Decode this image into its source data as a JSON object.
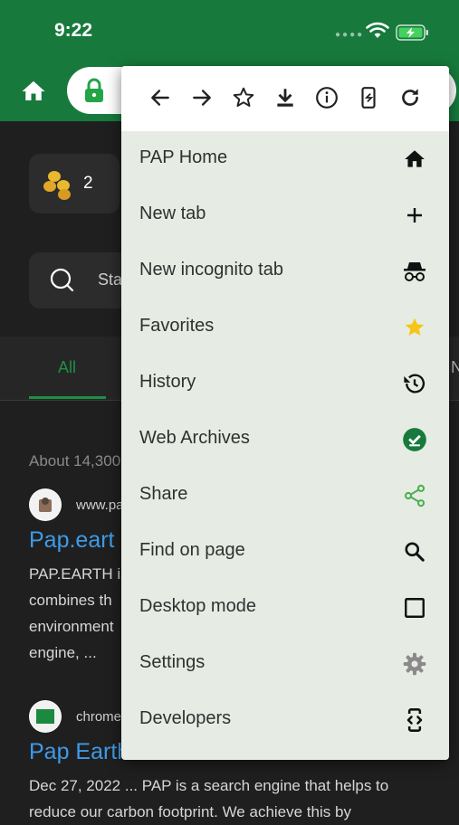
{
  "status_bar": {
    "time": "9:22"
  },
  "background_page": {
    "coins": {
      "count": "2"
    },
    "search": {
      "placeholder": "Sta"
    },
    "tabs": [
      {
        "label": "All"
      },
      {
        "label": "N"
      }
    ],
    "results_count": "About 14,300",
    "results": [
      {
        "domain": "www.pa",
        "title": "Pap.eart",
        "snippet": [
          "PAP.EARTH is",
          "combines th",
          "environment",
          "engine, ..."
        ]
      },
      {
        "domain": "chrome",
        "title": "Pap Earth",
        "snippet": [
          "Dec 27, 2022 ... PAP is a search engine that helps to",
          "reduce our carbon footprint. We achieve this by"
        ]
      }
    ]
  },
  "menu": {
    "toolbar": [
      {
        "icon": "back-arrow-icon"
      },
      {
        "icon": "forward-arrow-icon"
      },
      {
        "icon": "star-outline-icon"
      },
      {
        "icon": "download-icon"
      },
      {
        "icon": "info-icon"
      },
      {
        "icon": "phone-view-icon"
      },
      {
        "icon": "refresh-icon"
      }
    ],
    "items": [
      {
        "label": "PAP Home",
        "icon": "home-icon"
      },
      {
        "label": "New tab",
        "icon": "plus-icon"
      },
      {
        "label": "New incognito tab",
        "icon": "incognito-icon"
      },
      {
        "label": "Favorites",
        "icon": "star-icon"
      },
      {
        "label": "History",
        "icon": "history-icon"
      },
      {
        "label": "Web Archives",
        "icon": "check-circle-icon"
      },
      {
        "label": "Share",
        "icon": "share-icon"
      },
      {
        "label": "Find on page",
        "icon": "search-icon"
      },
      {
        "label": "Desktop mode",
        "icon": "checkbox-icon"
      },
      {
        "label": "Settings",
        "icon": "gear-icon"
      },
      {
        "label": "Developers",
        "icon": "developer-icon"
      }
    ]
  },
  "colors": {
    "brand_green": "#177a3c",
    "link_blue": "#3e9be8",
    "menu_background": "#e6ece4",
    "favorites_star": "#f5c518",
    "share_green": "#4caf50"
  }
}
